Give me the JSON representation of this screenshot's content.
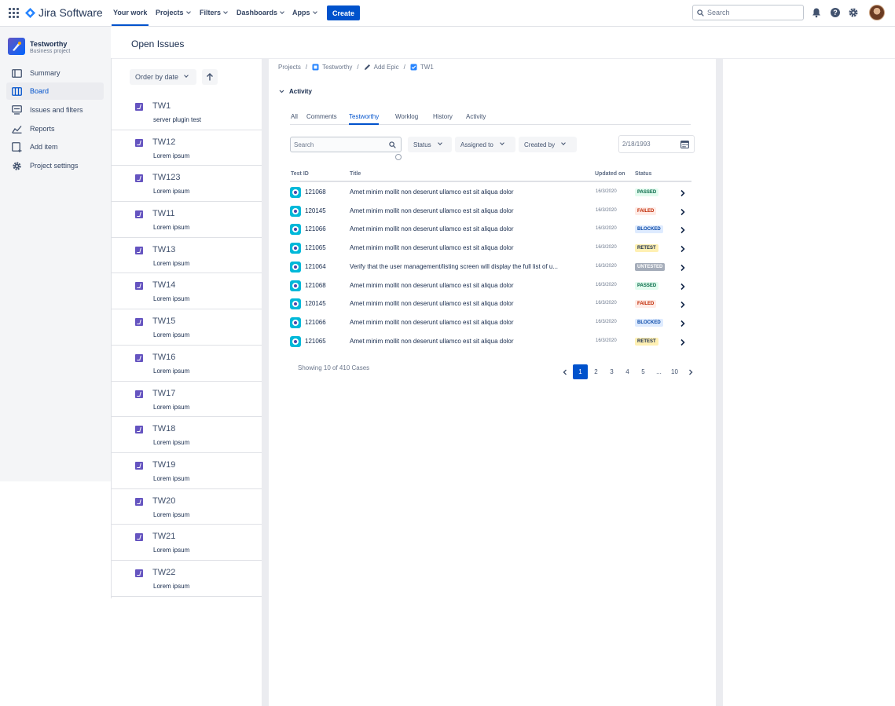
{
  "topnav": {
    "brand": "Jira Software",
    "items": [
      {
        "label": "Your work"
      },
      {
        "label": "Projects"
      },
      {
        "label": "Filters"
      },
      {
        "label": "Dashboards"
      },
      {
        "label": "Apps"
      }
    ],
    "create_label": "Create",
    "search_placeholder": "Search"
  },
  "sidebar": {
    "project_name": "Testworthy",
    "project_type": "Business project",
    "items": [
      {
        "label": "Summary",
        "icon": "summary-icon"
      },
      {
        "label": "Board",
        "icon": "board-icon"
      },
      {
        "label": "Issues and filters",
        "icon": "issues-icon"
      },
      {
        "label": "Reports",
        "icon": "reports-icon"
      },
      {
        "label": "Add item",
        "icon": "add-item-icon"
      },
      {
        "label": "Project settings",
        "icon": "gear-icon"
      }
    ]
  },
  "list": {
    "title": "Open Issues",
    "order_label": "Order by date",
    "issues": [
      {
        "key": "TW1",
        "summary": "server plugin test"
      },
      {
        "key": "TW12",
        "summary": "Lorem ipsum"
      },
      {
        "key": "TW123",
        "summary": "Lorem ipsum"
      },
      {
        "key": "TW11",
        "summary": "Lorem ipsum"
      },
      {
        "key": "TW13",
        "summary": "Lorem ipsum"
      },
      {
        "key": "TW14",
        "summary": "Lorem ipsum"
      },
      {
        "key": "TW15",
        "summary": "Lorem ipsum"
      },
      {
        "key": "TW16",
        "summary": "Lorem ipsum"
      },
      {
        "key": "TW17",
        "summary": "Lorem ipsum"
      },
      {
        "key": "TW18",
        "summary": "Lorem ipsum"
      },
      {
        "key": "TW19",
        "summary": "Lorem ipsum"
      },
      {
        "key": "TW20",
        "summary": "Lorem ipsum"
      },
      {
        "key": "TW21",
        "summary": "Lorem ipsum"
      },
      {
        "key": "TW22",
        "summary": "Lorem ipsum"
      }
    ]
  },
  "detail": {
    "breadcrumb": [
      "Projects",
      "Testworthy",
      "Add Epic",
      "TW1"
    ],
    "activity_label": "Activity",
    "tabs": [
      "All",
      "Comments",
      "Testworthy",
      "Worklog",
      "History",
      "Activity"
    ],
    "search_placeholder": "Search",
    "filters": [
      "Status",
      "Assigned to",
      "Created by"
    ],
    "date_placeholder": "2/18/1993",
    "columns": [
      "Test ID",
      "Title",
      "Updated on",
      "Status"
    ],
    "rows": [
      {
        "id": "121068",
        "title": "Amet minim mollit non deserunt ullamco est sit aliqua dolor",
        "date": "16/3/2020",
        "status": "PASSED"
      },
      {
        "id": "120145",
        "title": "Amet minim mollit non deserunt ullamco est sit aliqua dolor",
        "date": "16/3/2020",
        "status": "FAILED"
      },
      {
        "id": "121066",
        "title": "Amet minim mollit non deserunt ullamco est sit aliqua dolor",
        "date": "16/3/2020",
        "status": "BLOCKED"
      },
      {
        "id": "121065",
        "title": "Amet minim mollit non deserunt ullamco est sit aliqua dolor",
        "date": "16/3/2020",
        "status": "RETEST"
      },
      {
        "id": "121064",
        "title": "Verify that the user management/listing screen will display the full list of u...",
        "date": "16/3/2020",
        "status": "UNTESTED"
      },
      {
        "id": "121068",
        "title": "Amet minim mollit non deserunt ullamco est sit aliqua dolor",
        "date": "16/3/2020",
        "status": "PASSED"
      },
      {
        "id": "120145",
        "title": "Amet minim mollit non deserunt ullamco est sit aliqua dolor",
        "date": "16/3/2020",
        "status": "FAILED"
      },
      {
        "id": "121066",
        "title": "Amet minim mollit non deserunt ullamco est sit aliqua dolor",
        "date": "16/3/2020",
        "status": "BLOCKED"
      },
      {
        "id": "121065",
        "title": "Amet minim mollit non deserunt ullamco est sit aliqua dolor",
        "date": "16/3/2020",
        "status": "RETEST"
      }
    ],
    "showing_text": "Showing 10 of 410 Cases",
    "pages": [
      "1",
      "2",
      "3",
      "4",
      "5",
      "...",
      "10"
    ],
    "current_page": "1"
  },
  "colors": {
    "brand": "#0052CC",
    "sidebar_bg": "#F4F5F7",
    "story": "#6554C0"
  }
}
